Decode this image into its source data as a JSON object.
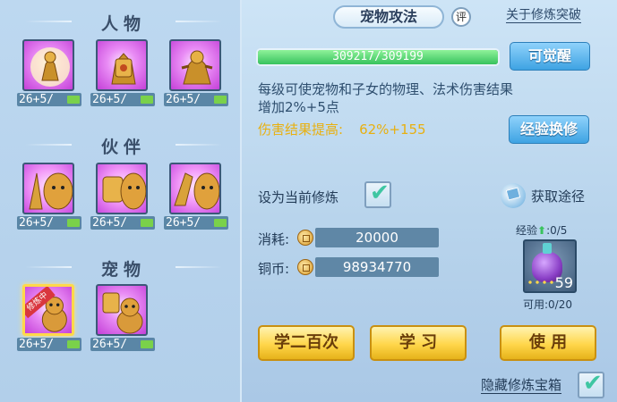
{
  "left": {
    "sections": [
      {
        "title": "人物",
        "slots": [
          {
            "label": "26+5/",
            "icon": "gold-figure-glow-icon"
          },
          {
            "label": "26+5/",
            "icon": "gold-shield-warrior-icon"
          },
          {
            "label": "26+5/",
            "icon": "gold-warrior-icon"
          }
        ]
      },
      {
        "title": "伙伴",
        "slots": [
          {
            "label": "26+5/",
            "icon": "lion-sword-icon"
          },
          {
            "label": "26+5/",
            "icon": "lion-shield-icon"
          },
          {
            "label": "26+5/",
            "icon": "lion-boot-icon"
          }
        ]
      },
      {
        "title": "宠物",
        "slots": [
          {
            "label": "26+5/",
            "icon": "cat-pet-icon",
            "selected": true,
            "badge": "修炼中"
          },
          {
            "label": "26+5/",
            "icon": "cat-shield-pet-icon"
          }
        ]
      }
    ]
  },
  "header": {
    "tab_title": "宠物攻法",
    "rate_label": "评",
    "link_label": "关于修炼突破"
  },
  "progress": {
    "text": "309217/309199",
    "fraction": 1.0
  },
  "buttons": {
    "awaken": "可觉醒",
    "exchange": "经验换修",
    "learn_hundred": "学二百次",
    "learn": "学 习",
    "use": "使 用"
  },
  "description": "每级可使宠物和子女的物理、法术伤害结果增加2%+5点",
  "bonus": {
    "label": "伤害结果提高:",
    "value": "62%+155"
  },
  "set_current": {
    "label": "设为当前修炼",
    "checked": true
  },
  "get_path": "获取途径",
  "costs": [
    {
      "label": "消耗:",
      "value": "20000"
    },
    {
      "label": "铜币:",
      "value": "98934770"
    }
  ],
  "experience": {
    "label": "经验",
    "value": ":0/5"
  },
  "item": {
    "count": "59",
    "usable": "可用:0/20"
  },
  "hide_chest": {
    "label": "隐藏修炼宝箱",
    "checked": true
  },
  "colors": {
    "accent_blue": "#3ea3e3",
    "accent_gold": "#ffd64a",
    "bonus_yellow": "#e8b010",
    "progress_green": "#37c25d"
  }
}
